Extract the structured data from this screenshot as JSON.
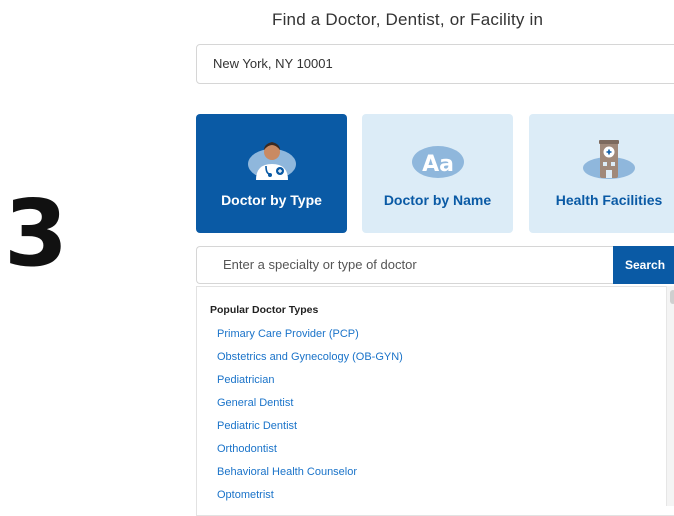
{
  "step": {
    "number": "3"
  },
  "header": {
    "title": "Find a Doctor, Dentist, or Facility in"
  },
  "location": {
    "value": "New York, NY 10001"
  },
  "tiles": [
    {
      "label": "Doctor by Type",
      "icon": "doctor-icon",
      "active": true
    },
    {
      "label": "Doctor by Name",
      "icon": "text-aa-icon",
      "active": false
    },
    {
      "label": "Health Facilities",
      "icon": "hospital-icon",
      "active": false
    }
  ],
  "search": {
    "placeholder": "Enter a specialty or type of doctor",
    "button_label": "Search"
  },
  "dropdown": {
    "title": "Popular Doctor Types",
    "items": [
      "Primary Care Provider (PCP)",
      "Obstetrics and Gynecology (OB-GYN)",
      "Pediatrician",
      "General Dentist",
      "Pediatric Dentist",
      "Orthodontist",
      "Behavioral Health Counselor",
      "Optometrist"
    ]
  },
  "colors": {
    "primary": "#0a5aa5",
    "tile_inactive": "#dcecf7",
    "link": "#1a73c9"
  }
}
